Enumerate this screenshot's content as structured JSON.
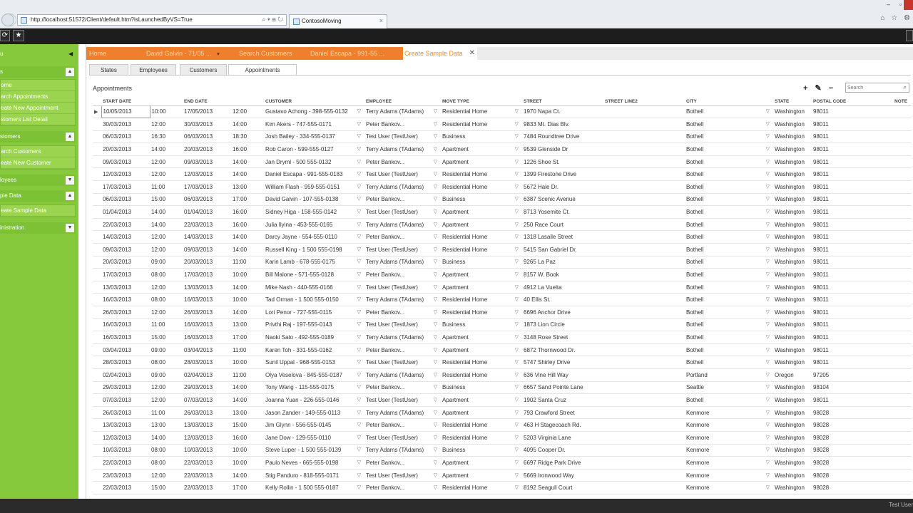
{
  "browser": {
    "address": "http://localhost:51572/Client/default.htm?isLaunchedByVS=True",
    "tab_title": "ContosoMoving",
    "tab_close": "×",
    "nav_forward": "→",
    "addr_tools": "⌕ ▾ ⊞ ↻",
    "win_min": "–",
    "win_max": "▫",
    "icons": [
      "⌂",
      "☆",
      "⚙"
    ]
  },
  "toolbar": {
    "refresh": "⟳",
    "star": "★"
  },
  "sidebar": {
    "collapse": "◀",
    "menu_title": "u",
    "groups": [
      {
        "title": "s",
        "toggle": "▲",
        "items": [
          "ome",
          "arch Appointments",
          "eate New Appointment",
          "stomers List Detail"
        ]
      },
      {
        "title": "stomers",
        "toggle": "▲",
        "items": [
          "arch Customers",
          "eate New Customer"
        ]
      },
      {
        "title": "loyees",
        "toggle": "▼",
        "items": []
      },
      {
        "title": "ple Data",
        "toggle": "▲",
        "items": [
          "eate Sample Data"
        ]
      },
      {
        "title": "inistration",
        "toggle": "▼",
        "items": []
      }
    ]
  },
  "main_tabs": [
    {
      "label": "Home"
    },
    {
      "label": "David Galvin - 71/05 ...",
      "arrow": "▼"
    },
    {
      "label": "Search Customers"
    },
    {
      "label": "Daniel Escapa - 991-55 ..."
    }
  ],
  "active_tab": {
    "label": "Create Sample Data",
    "close": "✕"
  },
  "sub_tabs": [
    "States",
    "Employees",
    "Customers",
    "Appointments"
  ],
  "screen_title": "Appointments",
  "grid_tools": {
    "add": "+",
    "edit": "✎",
    "delete": "−"
  },
  "search": {
    "placeholder": "Search",
    "icon": "⌕"
  },
  "table": {
    "columns": [
      "START DATE",
      "",
      "END DATE",
      "",
      "CUSTOMER",
      "EMPLOYEE",
      "MOVE TYPE",
      "STREET",
      "STREET LINE2",
      "CITY",
      "STATE",
      "POSTAL CODE",
      "NOTE"
    ],
    "row_marker": "▶",
    "dropdown_arrow": "▽",
    "rows": [
      [
        "10/05/2013",
        "10:00",
        "17/05/2013",
        "12:00",
        "Gustavo Achong - 398-555-0132",
        "Terry Adams (TAdams)",
        "Residential Home",
        "1970 Napa Ct.",
        "",
        "Bothell",
        "Washington",
        "98011"
      ],
      [
        "30/03/2013",
        "12:00",
        "30/03/2013",
        "14:00",
        "Kim Akers - 747-555-0171",
        "Peter Bankov...",
        "Residential Home",
        "9833 Mt. Dias Blv.",
        "",
        "Bothell",
        "Washington",
        "98011"
      ],
      [
        "06/03/2013",
        "16:30",
        "06/03/2013",
        "18:30",
        "Josh Bailey - 334-555-0137",
        "Test User (TestUser)",
        "Business",
        "7484 Roundtree Drive",
        "",
        "Bothell",
        "Washington",
        "98011"
      ],
      [
        "20/03/2013",
        "14:00",
        "20/03/2013",
        "16:00",
        "Rob Caron - 599-555-0127",
        "Terry Adams (TAdams)",
        "Apartment",
        "9539 Glenside Dr",
        "",
        "Bothell",
        "Washington",
        "98011"
      ],
      [
        "09/03/2013",
        "12:00",
        "09/03/2013",
        "14:00",
        "Jan Dryml - 500 555-0132",
        "Peter Bankov...",
        "Apartment",
        "1226 Shoe St.",
        "",
        "Bothell",
        "Washington",
        "98011"
      ],
      [
        "12/03/2013",
        "12:00",
        "12/03/2013",
        "14:00",
        "Daniel Escapa - 991-555-0183",
        "Test User (TestUser)",
        "Residential Home",
        "1399 Firestone Drive",
        "",
        "Bothell",
        "Washington",
        "98011"
      ],
      [
        "17/03/2013",
        "11:00",
        "17/03/2013",
        "13:00",
        "William Flash - 959-555-0151",
        "Terry Adams (TAdams)",
        "Residential Home",
        "5672 Hale Dr.",
        "",
        "Bothell",
        "Washington",
        "98011"
      ],
      [
        "06/03/2013",
        "15:00",
        "06/03/2013",
        "17:00",
        "David Galvin - 107-555-0138",
        "Peter Bankov...",
        "Business",
        "6387 Scenic Avenue",
        "",
        "Bothell",
        "Washington",
        "98011"
      ],
      [
        "01/04/2013",
        "14:00",
        "01/04/2013",
        "16:00",
        "Sidney Higa - 158-555-0142",
        "Test User (TestUser)",
        "Apartment",
        "8713 Yosemite Ct.",
        "",
        "Bothell",
        "Washington",
        "98011"
      ],
      [
        "22/03/2013",
        "14:00",
        "22/03/2013",
        "16:00",
        "Julia Ilyina - 453-555-0165",
        "Terry Adams (TAdams)",
        "Apartment",
        "250 Race Court",
        "",
        "Bothell",
        "Washington",
        "98011"
      ],
      [
        "14/03/2013",
        "12:00",
        "14/03/2013",
        "14:00",
        "Darcy Jayne - 554-555-0110",
        "Peter Bankov...",
        "Residential Home",
        "1318 Lasalle Street",
        "",
        "Bothell",
        "Washington",
        "98011"
      ],
      [
        "09/03/2013",
        "12:00",
        "09/03/2013",
        "14:00",
        "Russell King - 1 500 555-0198",
        "Test User (TestUser)",
        "Residential Home",
        "5415 San Gabriel Dr.",
        "",
        "Bothell",
        "Washington",
        "98011"
      ],
      [
        "20/03/2013",
        "09:00",
        "20/03/2013",
        "11:00",
        "Karin Lamb - 678-555-0175",
        "Terry Adams (TAdams)",
        "Business",
        "9265 La Paz",
        "",
        "Bothell",
        "Washington",
        "98011"
      ],
      [
        "17/03/2013",
        "08:00",
        "17/03/2013",
        "10:00",
        "Bill Malone - 571-555-0128",
        "Peter Bankov...",
        "Apartment",
        "8157 W. Book",
        "",
        "Bothell",
        "Washington",
        "98011"
      ],
      [
        "13/03/2013",
        "12:00",
        "13/03/2013",
        "14:00",
        "Mike Nash - 440-555-0166",
        "Test User (TestUser)",
        "Apartment",
        "4912 La Vuelta",
        "",
        "Bothell",
        "Washington",
        "98011"
      ],
      [
        "16/03/2013",
        "08:00",
        "16/03/2013",
        "10:00",
        "Tad Orman - 1 500 555-0150",
        "Terry Adams (TAdams)",
        "Residential Home",
        "40 Ellis St.",
        "",
        "Bothell",
        "Washington",
        "98011"
      ],
      [
        "26/03/2013",
        "12:00",
        "26/03/2013",
        "14:00",
        "Lori Penor - 727-555-0115",
        "Peter Bankov...",
        "Residential Home",
        "6696 Anchor Drive",
        "",
        "Bothell",
        "Washington",
        "98011"
      ],
      [
        "16/03/2013",
        "11:00",
        "16/03/2013",
        "13:00",
        "Privthi Raj - 197-555-0143",
        "Test User (TestUser)",
        "Business",
        "1873 Lion Circle",
        "",
        "Bothell",
        "Washington",
        "98011"
      ],
      [
        "16/03/2013",
        "15:00",
        "16/03/2013",
        "17:00",
        "Naoki Sato - 492-555-0189",
        "Terry Adams (TAdams)",
        "Apartment",
        "3148 Rose Street",
        "",
        "Bothell",
        "Washington",
        "98011"
      ],
      [
        "03/04/2013",
        "09:00",
        "03/04/2013",
        "11:00",
        "Karen Toh - 331-555-0162",
        "Peter Bankov...",
        "Apartment",
        "6872 Thornwood Dr.",
        "",
        "Bothell",
        "Washington",
        "98011"
      ],
      [
        "28/03/2013",
        "08:00",
        "28/03/2013",
        "10:00",
        "Sunil Uppal - 968-555-0153",
        "Test User (TestUser)",
        "Residential Home",
        "5747 Shirley Drive",
        "",
        "Bothell",
        "Washington",
        "98011"
      ],
      [
        "02/04/2013",
        "09:00",
        "02/04/2013",
        "11:00",
        "Olya Veselova - 845-555-0187",
        "Terry Adams (TAdams)",
        "Residential Home",
        "636 Vine Hill Way",
        "",
        "Portland",
        "Oregon",
        "97205"
      ],
      [
        "29/03/2013",
        "12:00",
        "29/03/2013",
        "14:00",
        "Tony Wang - 115-555-0175",
        "Peter Bankov...",
        "Business",
        "6657 Sand Pointe Lane",
        "",
        "Seattle",
        "Washington",
        "98104"
      ],
      [
        "07/03/2013",
        "12:00",
        "07/03/2013",
        "14:00",
        "Joanna Yuan - 226-555-0146",
        "Test User (TestUser)",
        "Apartment",
        "1902 Santa Cruz",
        "",
        "Bothell",
        "Washington",
        "98011"
      ],
      [
        "26/03/2013",
        "11:00",
        "26/03/2013",
        "13:00",
        "Jason Zander - 149-555-0113",
        "Terry Adams (TAdams)",
        "Apartment",
        "793 Crawford Street",
        "",
        "Kenmore",
        "Washington",
        "98028"
      ],
      [
        "13/03/2013",
        "13:00",
        "13/03/2013",
        "15:00",
        "Jim Glynn - 556-555-0145",
        "Peter Bankov...",
        "Residential Home",
        "463 H Stagecoach Rd.",
        "",
        "Kenmore",
        "Washington",
        "98028"
      ],
      [
        "12/03/2013",
        "14:00",
        "12/03/2013",
        "16:00",
        "Jane Dow - 129-555-0110",
        "Test User (TestUser)",
        "Residential Home",
        "5203 Virginia Lane",
        "",
        "Kenmore",
        "Washington",
        "98028"
      ],
      [
        "10/03/2013",
        "08:00",
        "10/03/2013",
        "10:00",
        "Steve Luper - 1 500 555-0139",
        "Terry Adams (TAdams)",
        "Business",
        "4095 Cooper Dr.",
        "",
        "Kenmore",
        "Washington",
        "98028"
      ],
      [
        "22/03/2013",
        "08:00",
        "22/03/2013",
        "10:00",
        "Paulo Neves - 665-555-0198",
        "Peter Bankov...",
        "Apartment",
        "6697 Ridge Park Drive",
        "",
        "Kenmore",
        "Washington",
        "98028"
      ],
      [
        "23/03/2013",
        "12:00",
        "22/03/2013",
        "14:00",
        "Stig Panduro - 818-555-0171",
        "Test User (TestUser)",
        "Apartment",
        "5669 Ironwood Way",
        "",
        "Kenmore",
        "Washington",
        "98028"
      ],
      [
        "22/03/2013",
        "15:00",
        "22/03/2013",
        "17:00",
        "Kelly Rollin - 1 500 555-0187",
        "Peter Bankov...",
        "Residential Home",
        "8192 Seagull Court",
        "",
        "Kenmore",
        "Washington",
        "98028"
      ]
    ]
  },
  "status": {
    "user": "Test User"
  }
}
